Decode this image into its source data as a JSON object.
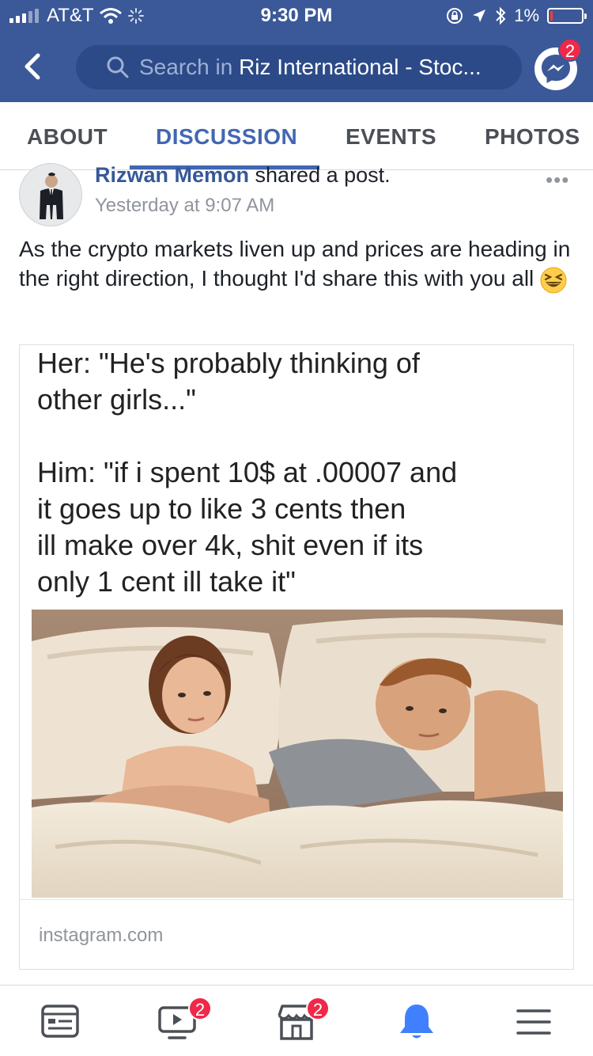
{
  "status_bar": {
    "carrier": "AT&T",
    "time": "9:30 PM",
    "battery": "1%",
    "battery_level": 0.01
  },
  "header": {
    "search_prefix": "Search in",
    "search_group": "Riz International - Stoc...",
    "messenger_badge": "2",
    "colors": {
      "bar": "#3b5998",
      "search_bg": "#2c4a88",
      "badge": "#f02849"
    }
  },
  "tabs": [
    {
      "label": "ABOUT",
      "active": false
    },
    {
      "label": "DISCUSSION",
      "active": true
    },
    {
      "label": "EVENTS",
      "active": false
    },
    {
      "label": "PHOTOS",
      "active": false
    }
  ],
  "post": {
    "author": "Rizwan Memon",
    "action": "shared a post.",
    "time": "Yesterday at 9:07 AM",
    "more": "•••",
    "text": "As the crypto markets liven up and prices are heading in the right direction, I thought I'd share this with you all",
    "emoji": "grinning-squinting-face",
    "shared": {
      "caption_her_1": "Her: \"He's probably thinking of",
      "caption_her_2": "other girls...\"",
      "caption_him_1": "Him: \"if i spent 10$ at .00007 and",
      "caption_him_2": "it goes up to like 3 cents then",
      "caption_him_3": "ill make over 4k, shit even if its",
      "caption_him_4": "only 1 cent ill take it\"",
      "source": "instagram.com"
    }
  },
  "bottom_nav": [
    {
      "name": "news-feed-icon",
      "badge": ""
    },
    {
      "name": "video-icon",
      "badge": "2"
    },
    {
      "name": "marketplace-icon",
      "badge": "2"
    },
    {
      "name": "notifications-icon",
      "badge": ""
    },
    {
      "name": "menu-icon",
      "badge": ""
    }
  ]
}
